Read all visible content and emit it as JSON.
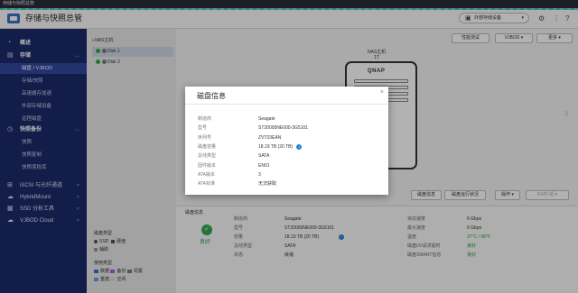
{
  "window_title": "存储与快照总管",
  "app": {
    "title": "存储与快照总管",
    "ext_device_label": "外部存储设备"
  },
  "sidebar": {
    "overview": "概述",
    "storage": "存储",
    "storage_items": [
      "磁盘 / VJBOD",
      "存储/快照",
      "高速缓存加速",
      "外部存储设备",
      "远程磁盘"
    ],
    "snapshot_backup": "快照备份",
    "snapshot_items": [
      "快照",
      "快照复制",
      "快照保险库"
    ],
    "bottom_items": [
      "iSCSI 与光纤通道",
      "HybridMount",
      "SSD 分析工具",
      "VJBOD Cloud"
    ]
  },
  "tree": {
    "root": "NAS主机",
    "disks": [
      "Disk 1",
      "Disk 2"
    ]
  },
  "toolbar": {
    "perf_test": "性能测试",
    "vjbod": "VJBOD",
    "more": "更多"
  },
  "device": {
    "label": "NAS主机",
    "sublabel": "1T",
    "brand": "QNAP"
  },
  "modal": {
    "title": "磁盘信息",
    "rows": [
      {
        "k": "制造商",
        "v": "Seagate",
        "info": false
      },
      {
        "k": "型号",
        "v": "ST20000NE000-3G5101",
        "info": false
      },
      {
        "k": "序列号",
        "v": "ZVT03EAN",
        "info": false
      },
      {
        "k": "磁盘容量",
        "v": "18.19 TB (20 TB)",
        "info": true
      },
      {
        "k": "总线类型",
        "v": "SATA",
        "info": false
      },
      {
        "k": "固件版本",
        "v": "EN01",
        "info": false
      },
      {
        "k": "ATA版本",
        "v": "3",
        "info": false
      },
      {
        "k": "ATA标准",
        "v": "无法获取",
        "info": false
      }
    ]
  },
  "actions": {
    "disk_info": "磁盘信息",
    "disk_health": "磁盘运行状况",
    "operate": "操作",
    "raid": "RAID 组"
  },
  "bottom": {
    "section_title": "磁盘信息",
    "health_label": "良好",
    "left_rows": [
      {
        "k": "制造商",
        "v": "Seagate"
      },
      {
        "k": "型号",
        "v": "ST20000NE000-3G5101"
      },
      {
        "k": "容量",
        "v": "18.19 TB (20 TB)"
      },
      {
        "k": "总线类型",
        "v": "SATA"
      },
      {
        "k": "状态",
        "v": "就绪"
      }
    ],
    "right_rows": [
      {
        "k": "目前速度",
        "v": "6 Gbps"
      },
      {
        "k": "最大速度",
        "v": "6 Gbps"
      },
      {
        "k": "温度",
        "v": "37°C / 98°F"
      },
      {
        "k": "磁盘I/O请求超时",
        "v": "良好"
      },
      {
        "k": "磁盘SMART信息",
        "v": "良好"
      }
    ]
  },
  "legends": {
    "disk_type_title": "磁盘类型",
    "disk_types": [
      "SSD",
      "硬盘"
    ],
    "extra": "辅助",
    "usage_title": "使用类型",
    "usage_types": [
      "数据",
      "备份",
      "闲置",
      "重建",
      "空闲"
    ],
    "colors": {
      "data": "#3a6fd8",
      "backup": "#b55ad6",
      "idle": "#7a7a7a",
      "rebuild": "#5f9ee6",
      "free": "#d9d9d9"
    }
  }
}
